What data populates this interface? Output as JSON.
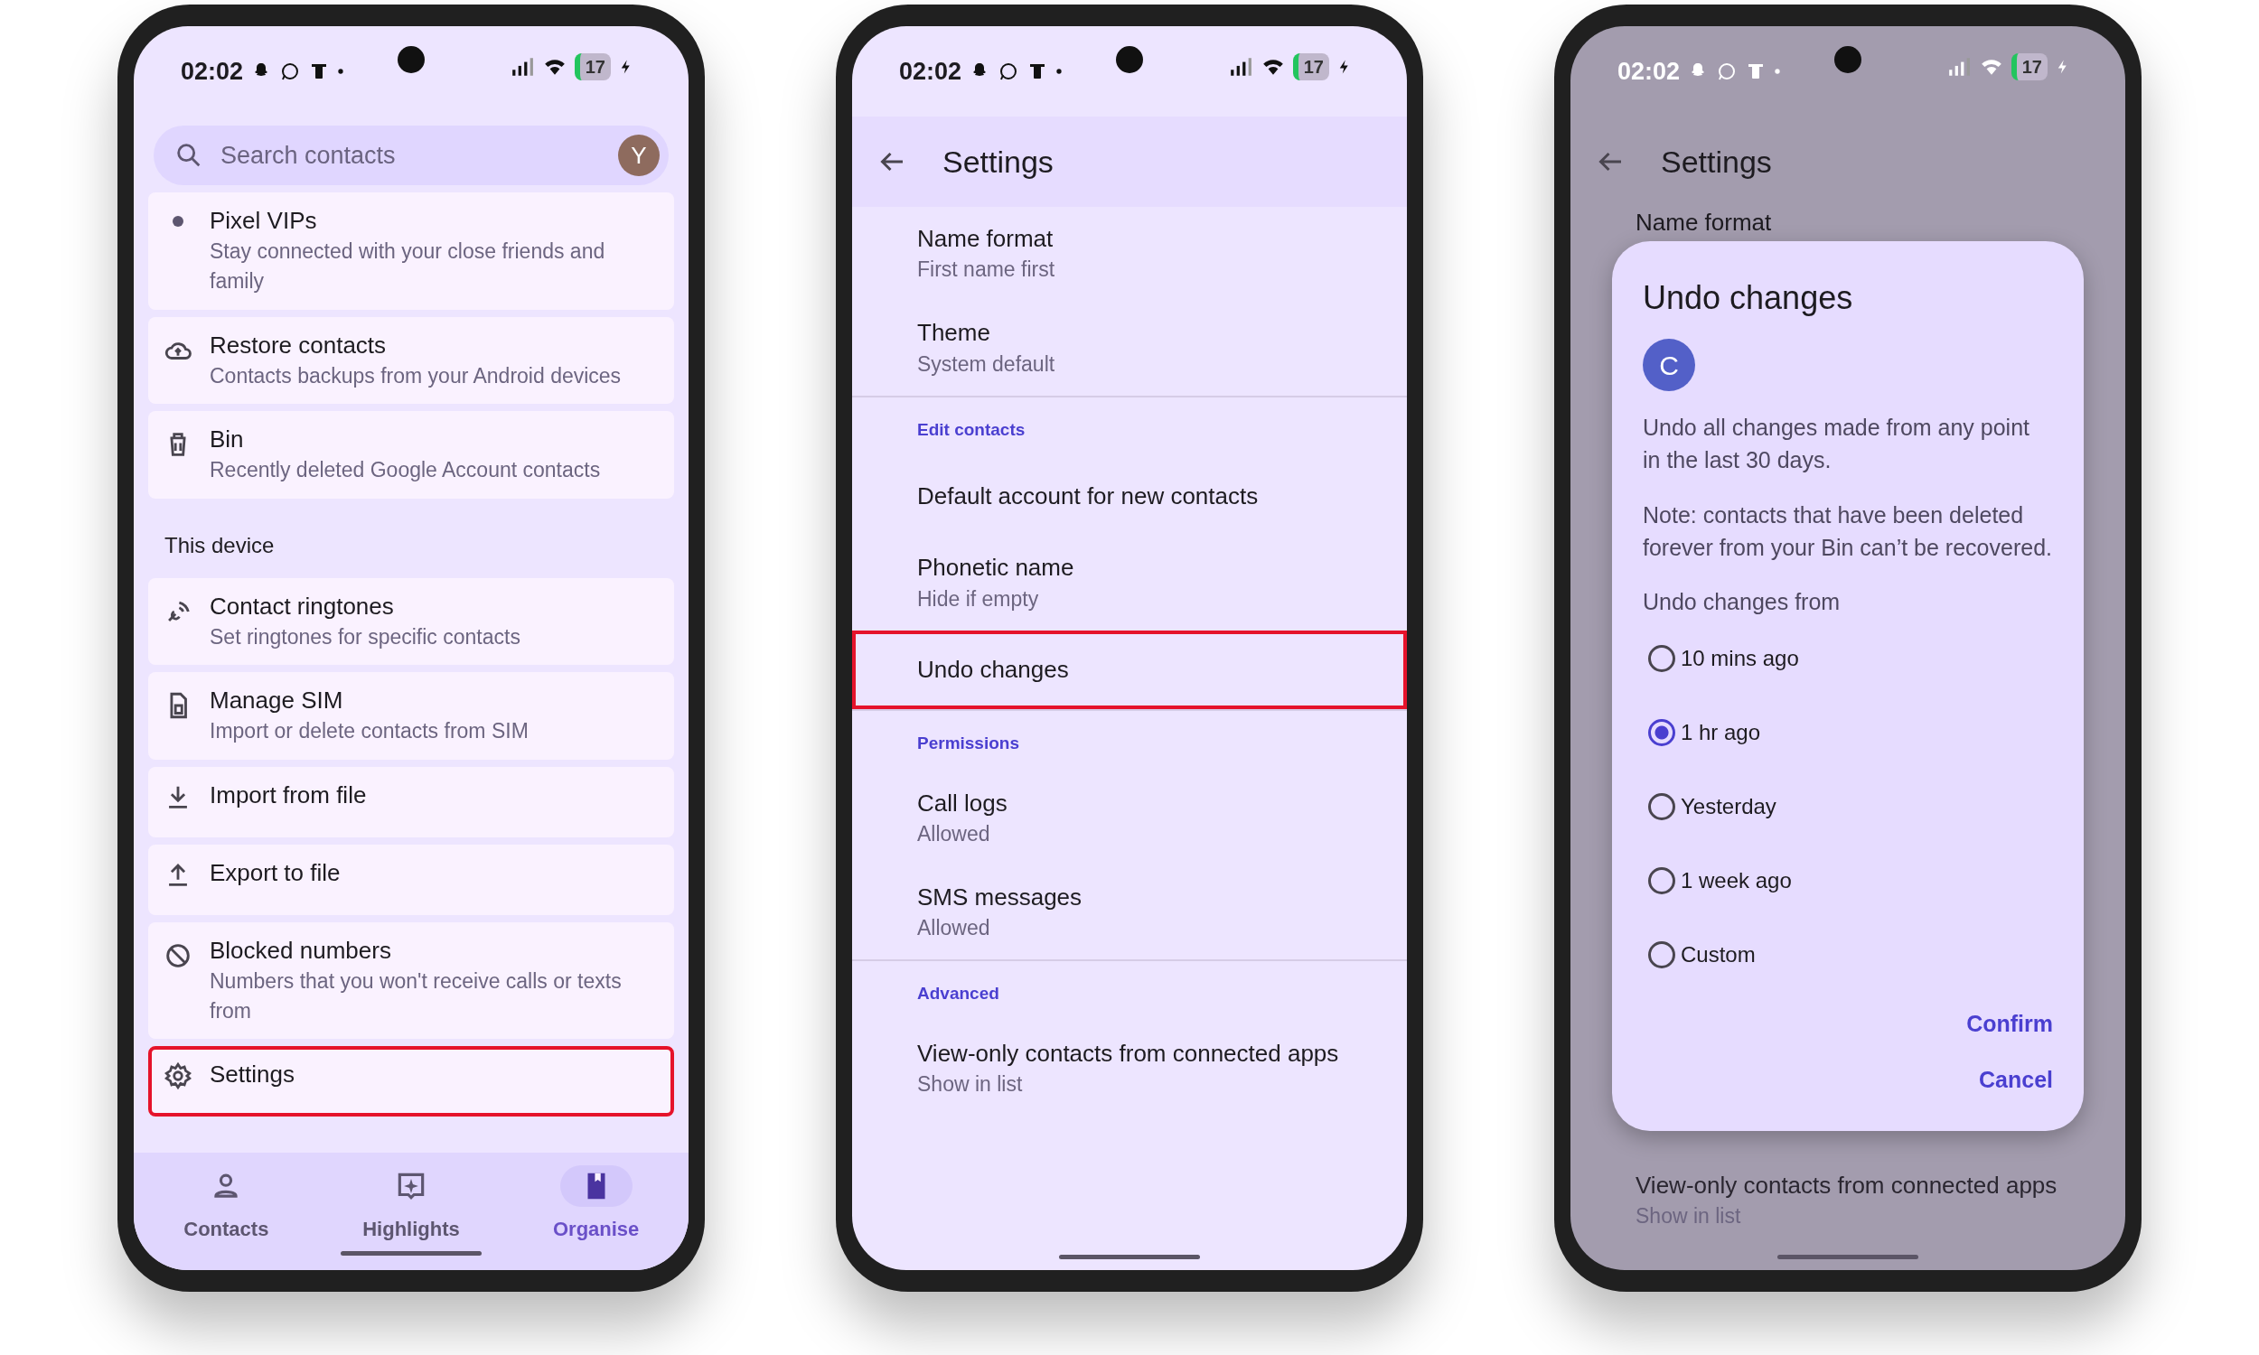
{
  "organise_screen": {
    "status_bar": {
      "time": "02:02",
      "battery": "17"
    },
    "search": {
      "placeholder": "Search contacts",
      "avatar": "Y"
    },
    "sections": [
      {
        "items": [
          {
            "title": "Pixel VIPs",
            "subtitle": "Stay connected with your close friends and family",
            "highlighted": false
          },
          {
            "title": "Restore contacts",
            "subtitle": "Contacts backups from your Android devices",
            "highlighted": false
          },
          {
            "title": "Bin",
            "subtitle": "Recently deleted Google Account contacts",
            "highlighted": false
          }
        ]
      },
      {
        "heading": "This device",
        "items": [
          {
            "title": "Contact ringtones",
            "subtitle": "Set ringtones for specific contacts",
            "highlighted": false
          },
          {
            "title": "Manage SIM",
            "subtitle": "Import or delete contacts from SIM",
            "highlighted": false
          },
          {
            "title": "Import from file",
            "highlighted": false
          },
          {
            "title": "Export to file",
            "highlighted": false
          },
          {
            "title": "Blocked numbers",
            "subtitle": "Numbers that you won't receive calls or texts from",
            "highlighted": false
          },
          {
            "title": "Settings",
            "highlighted": true
          }
        ]
      }
    ],
    "bottom_nav": [
      {
        "label": "Contacts",
        "selected": false
      },
      {
        "label": "Highlights",
        "selected": false
      },
      {
        "label": "Organise",
        "selected": true
      }
    ]
  },
  "settings_screen": {
    "status_bar": {
      "time": "02:02",
      "battery": "17"
    },
    "title": "Settings",
    "rows": [
      {
        "kind": "item",
        "title": "Name format",
        "subtitle": "First name first",
        "highlighted": false
      },
      {
        "kind": "item",
        "title": "Theme",
        "subtitle": "System default",
        "highlighted": false
      },
      {
        "kind": "heading",
        "title": "Edit contacts"
      },
      {
        "kind": "item",
        "title": "Default account for new contacts",
        "highlighted": false
      },
      {
        "kind": "item",
        "title": "Phonetic name",
        "subtitle": "Hide if empty",
        "highlighted": false
      },
      {
        "kind": "item",
        "title": "Undo changes",
        "highlighted": true
      },
      {
        "kind": "heading",
        "title": "Permissions"
      },
      {
        "kind": "item",
        "title": "Call logs",
        "subtitle": "Allowed",
        "highlighted": false
      },
      {
        "kind": "item",
        "title": "SMS messages",
        "subtitle": "Allowed",
        "highlighted": false
      },
      {
        "kind": "heading",
        "title": "Advanced"
      },
      {
        "kind": "item",
        "title": "View-only contacts from connected apps",
        "subtitle": "Show in list",
        "highlighted": false
      }
    ]
  },
  "dialog_screen": {
    "status_bar": {
      "time": "02:02",
      "battery": "17"
    },
    "title": "Settings",
    "top_row": {
      "title": "Name format"
    },
    "bottom_row": {
      "title": "View-only contacts from connected apps",
      "subtitle": "Show in list"
    },
    "dialog": {
      "title": "Undo changes",
      "avatar": "C",
      "text": "Undo all changes made from any point in the last 30 days.",
      "note": "Note: contacts that have been deleted forever from your Bin can’t be recovered.",
      "options_label": "Undo changes from",
      "options": [
        {
          "label": "10 mins ago",
          "selected": false
        },
        {
          "label": "1 hr ago",
          "selected": true
        },
        {
          "label": "Yesterday",
          "selected": false
        },
        {
          "label": "1 week ago",
          "selected": false
        },
        {
          "label": "Custom",
          "selected": false
        }
      ],
      "buttons": [
        "Confirm",
        "Cancel"
      ]
    }
  }
}
